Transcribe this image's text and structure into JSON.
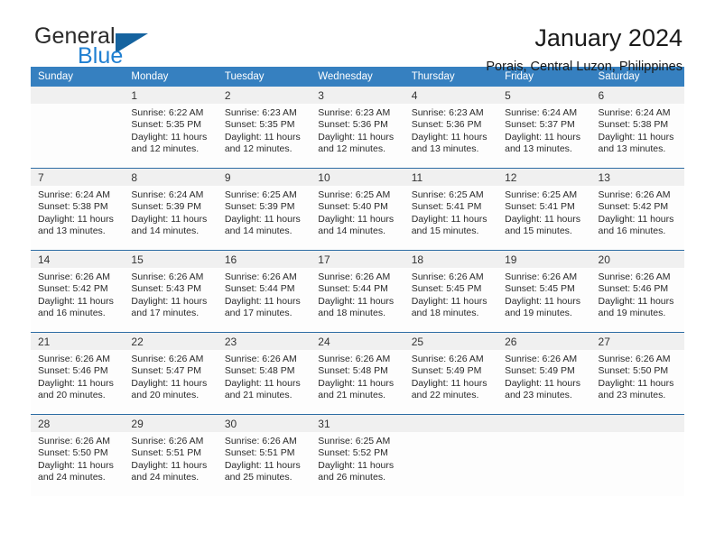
{
  "logo": {
    "word_one": "General",
    "word_two": "Blue",
    "triangle_color": "#15639f",
    "blue_color": "#1f7fd1"
  },
  "header": {
    "title": "January 2024",
    "subtitle": "Porais, Central Luzon, Philippines"
  },
  "theme": {
    "header_bg": "#3680c0",
    "row_divider": "#2e6da4",
    "daynum_bg": "#f0f0f0"
  },
  "calendar": {
    "weekday_headers": [
      "Sunday",
      "Monday",
      "Tuesday",
      "Wednesday",
      "Thursday",
      "Friday",
      "Saturday"
    ],
    "weeks": [
      [
        {
          "day": "",
          "empty": true,
          "sunrise": "",
          "sunset": "",
          "daylight_1": "",
          "daylight_2": ""
        },
        {
          "day": "1",
          "sunrise": "Sunrise: 6:22 AM",
          "sunset": "Sunset: 5:35 PM",
          "daylight_1": "Daylight: 11 hours",
          "daylight_2": "and 12 minutes."
        },
        {
          "day": "2",
          "sunrise": "Sunrise: 6:23 AM",
          "sunset": "Sunset: 5:35 PM",
          "daylight_1": "Daylight: 11 hours",
          "daylight_2": "and 12 minutes."
        },
        {
          "day": "3",
          "sunrise": "Sunrise: 6:23 AM",
          "sunset": "Sunset: 5:36 PM",
          "daylight_1": "Daylight: 11 hours",
          "daylight_2": "and 12 minutes."
        },
        {
          "day": "4",
          "sunrise": "Sunrise: 6:23 AM",
          "sunset": "Sunset: 5:36 PM",
          "daylight_1": "Daylight: 11 hours",
          "daylight_2": "and 13 minutes."
        },
        {
          "day": "5",
          "sunrise": "Sunrise: 6:24 AM",
          "sunset": "Sunset: 5:37 PM",
          "daylight_1": "Daylight: 11 hours",
          "daylight_2": "and 13 minutes."
        },
        {
          "day": "6",
          "sunrise": "Sunrise: 6:24 AM",
          "sunset": "Sunset: 5:38 PM",
          "daylight_1": "Daylight: 11 hours",
          "daylight_2": "and 13 minutes."
        }
      ],
      [
        {
          "day": "7",
          "sunrise": "Sunrise: 6:24 AM",
          "sunset": "Sunset: 5:38 PM",
          "daylight_1": "Daylight: 11 hours",
          "daylight_2": "and 13 minutes."
        },
        {
          "day": "8",
          "sunrise": "Sunrise: 6:24 AM",
          "sunset": "Sunset: 5:39 PM",
          "daylight_1": "Daylight: 11 hours",
          "daylight_2": "and 14 minutes."
        },
        {
          "day": "9",
          "sunrise": "Sunrise: 6:25 AM",
          "sunset": "Sunset: 5:39 PM",
          "daylight_1": "Daylight: 11 hours",
          "daylight_2": "and 14 minutes."
        },
        {
          "day": "10",
          "sunrise": "Sunrise: 6:25 AM",
          "sunset": "Sunset: 5:40 PM",
          "daylight_1": "Daylight: 11 hours",
          "daylight_2": "and 14 minutes."
        },
        {
          "day": "11",
          "sunrise": "Sunrise: 6:25 AM",
          "sunset": "Sunset: 5:41 PM",
          "daylight_1": "Daylight: 11 hours",
          "daylight_2": "and 15 minutes."
        },
        {
          "day": "12",
          "sunrise": "Sunrise: 6:25 AM",
          "sunset": "Sunset: 5:41 PM",
          "daylight_1": "Daylight: 11 hours",
          "daylight_2": "and 15 minutes."
        },
        {
          "day": "13",
          "sunrise": "Sunrise: 6:26 AM",
          "sunset": "Sunset: 5:42 PM",
          "daylight_1": "Daylight: 11 hours",
          "daylight_2": "and 16 minutes."
        }
      ],
      [
        {
          "day": "14",
          "sunrise": "Sunrise: 6:26 AM",
          "sunset": "Sunset: 5:42 PM",
          "daylight_1": "Daylight: 11 hours",
          "daylight_2": "and 16 minutes."
        },
        {
          "day": "15",
          "sunrise": "Sunrise: 6:26 AM",
          "sunset": "Sunset: 5:43 PM",
          "daylight_1": "Daylight: 11 hours",
          "daylight_2": "and 17 minutes."
        },
        {
          "day": "16",
          "sunrise": "Sunrise: 6:26 AM",
          "sunset": "Sunset: 5:44 PM",
          "daylight_1": "Daylight: 11 hours",
          "daylight_2": "and 17 minutes."
        },
        {
          "day": "17",
          "sunrise": "Sunrise: 6:26 AM",
          "sunset": "Sunset: 5:44 PM",
          "daylight_1": "Daylight: 11 hours",
          "daylight_2": "and 18 minutes."
        },
        {
          "day": "18",
          "sunrise": "Sunrise: 6:26 AM",
          "sunset": "Sunset: 5:45 PM",
          "daylight_1": "Daylight: 11 hours",
          "daylight_2": "and 18 minutes."
        },
        {
          "day": "19",
          "sunrise": "Sunrise: 6:26 AM",
          "sunset": "Sunset: 5:45 PM",
          "daylight_1": "Daylight: 11 hours",
          "daylight_2": "and 19 minutes."
        },
        {
          "day": "20",
          "sunrise": "Sunrise: 6:26 AM",
          "sunset": "Sunset: 5:46 PM",
          "daylight_1": "Daylight: 11 hours",
          "daylight_2": "and 19 minutes."
        }
      ],
      [
        {
          "day": "21",
          "sunrise": "Sunrise: 6:26 AM",
          "sunset": "Sunset: 5:46 PM",
          "daylight_1": "Daylight: 11 hours",
          "daylight_2": "and 20 minutes."
        },
        {
          "day": "22",
          "sunrise": "Sunrise: 6:26 AM",
          "sunset": "Sunset: 5:47 PM",
          "daylight_1": "Daylight: 11 hours",
          "daylight_2": "and 20 minutes."
        },
        {
          "day": "23",
          "sunrise": "Sunrise: 6:26 AM",
          "sunset": "Sunset: 5:48 PM",
          "daylight_1": "Daylight: 11 hours",
          "daylight_2": "and 21 minutes."
        },
        {
          "day": "24",
          "sunrise": "Sunrise: 6:26 AM",
          "sunset": "Sunset: 5:48 PM",
          "daylight_1": "Daylight: 11 hours",
          "daylight_2": "and 21 minutes."
        },
        {
          "day": "25",
          "sunrise": "Sunrise: 6:26 AM",
          "sunset": "Sunset: 5:49 PM",
          "daylight_1": "Daylight: 11 hours",
          "daylight_2": "and 22 minutes."
        },
        {
          "day": "26",
          "sunrise": "Sunrise: 6:26 AM",
          "sunset": "Sunset: 5:49 PM",
          "daylight_1": "Daylight: 11 hours",
          "daylight_2": "and 23 minutes."
        },
        {
          "day": "27",
          "sunrise": "Sunrise: 6:26 AM",
          "sunset": "Sunset: 5:50 PM",
          "daylight_1": "Daylight: 11 hours",
          "daylight_2": "and 23 minutes."
        }
      ],
      [
        {
          "day": "28",
          "sunrise": "Sunrise: 6:26 AM",
          "sunset": "Sunset: 5:50 PM",
          "daylight_1": "Daylight: 11 hours",
          "daylight_2": "and 24 minutes."
        },
        {
          "day": "29",
          "sunrise": "Sunrise: 6:26 AM",
          "sunset": "Sunset: 5:51 PM",
          "daylight_1": "Daylight: 11 hours",
          "daylight_2": "and 24 minutes."
        },
        {
          "day": "30",
          "sunrise": "Sunrise: 6:26 AM",
          "sunset": "Sunset: 5:51 PM",
          "daylight_1": "Daylight: 11 hours",
          "daylight_2": "and 25 minutes."
        },
        {
          "day": "31",
          "sunrise": "Sunrise: 6:25 AM",
          "sunset": "Sunset: 5:52 PM",
          "daylight_1": "Daylight: 11 hours",
          "daylight_2": "and 26 minutes."
        },
        {
          "day": "",
          "empty": true,
          "sunrise": "",
          "sunset": "",
          "daylight_1": "",
          "daylight_2": ""
        },
        {
          "day": "",
          "empty": true,
          "sunrise": "",
          "sunset": "",
          "daylight_1": "",
          "daylight_2": ""
        },
        {
          "day": "",
          "empty": true,
          "sunrise": "",
          "sunset": "",
          "daylight_1": "",
          "daylight_2": ""
        }
      ]
    ]
  }
}
